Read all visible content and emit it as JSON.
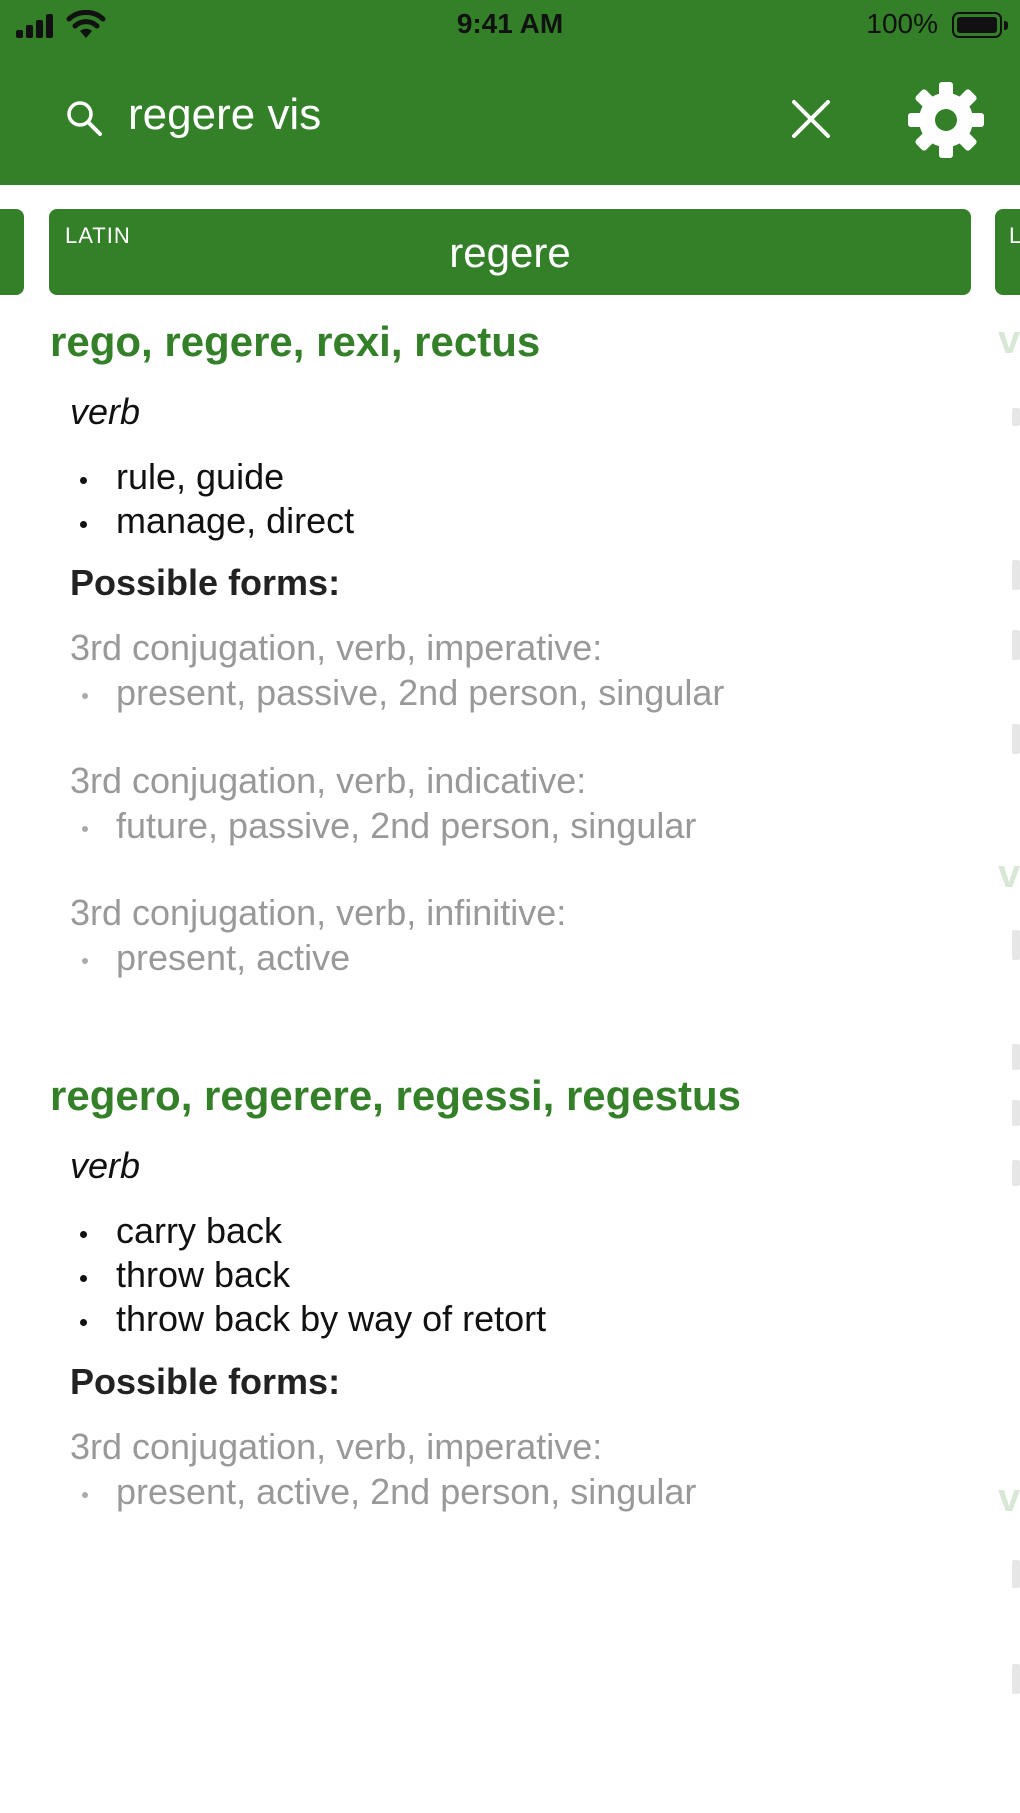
{
  "status_bar": {
    "time": "9:41 AM",
    "battery": "100%"
  },
  "search": {
    "query": "regere vis"
  },
  "tab": {
    "language": "LATIN",
    "word": "regere",
    "next_language_initial": "L"
  },
  "entries": [
    {
      "headword": "rego, regere, rexi, rectus",
      "part_of_speech": "verb",
      "definitions": [
        "rule, guide",
        "manage, direct"
      ],
      "forms_label": "Possible forms:",
      "forms": [
        {
          "type": "3rd conjugation, verb, imperative:",
          "detail": "present, passive, 2nd person, singular"
        },
        {
          "type": "3rd conjugation, verb, indicative:",
          "detail": "future, passive, 2nd person, singular"
        },
        {
          "type": "3rd conjugation, verb, infinitive:",
          "detail": "present, active"
        }
      ]
    },
    {
      "headword": "regero, regerere, regessi, regestus",
      "part_of_speech": "verb",
      "definitions": [
        "carry back",
        "throw back",
        "throw back by way of retort"
      ],
      "forms_label": "Possible forms:",
      "forms": [
        {
          "type": "3rd conjugation, verb, imperative:",
          "detail": "present, active, 2nd person, singular"
        }
      ]
    }
  ],
  "peek": {
    "letter": "v"
  },
  "icons": {
    "search": "search-icon",
    "clear": "close-icon",
    "settings": "gear-icon"
  },
  "colors": {
    "brand_green": "#338029",
    "muted_text": "#999999"
  }
}
